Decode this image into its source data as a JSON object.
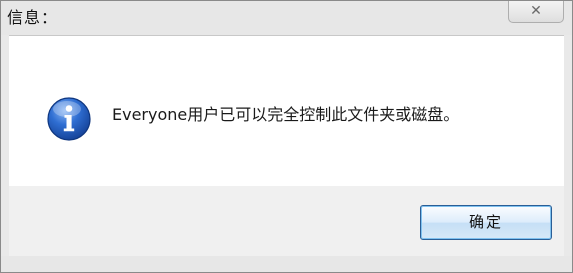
{
  "window": {
    "title": "信息："
  },
  "titlebar": {
    "close_glyph": "✕",
    "close_icon": "close-icon"
  },
  "content": {
    "icon": "info-icon",
    "message": "Everyone用户已可以完全控制此文件夹或磁盘。"
  },
  "footer": {
    "ok_label": "确定"
  }
}
